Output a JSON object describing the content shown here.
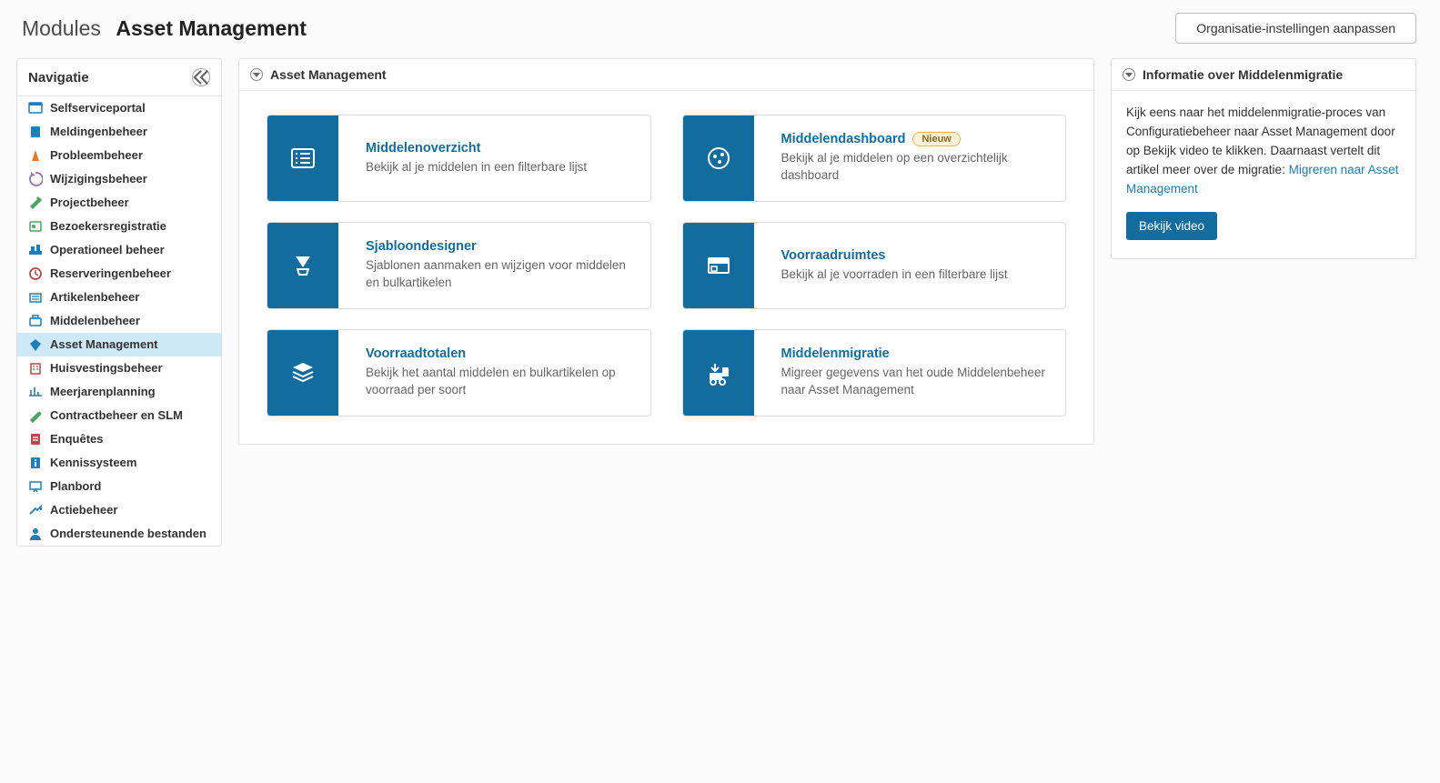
{
  "header": {
    "crumb1": "Modules",
    "crumb2": "Asset Management",
    "org_settings": "Organisatie-instellingen aanpassen"
  },
  "sidebar": {
    "title": "Navigatie",
    "items": [
      {
        "label": "Selfserviceportal",
        "icon": "portal",
        "name": "sidebar-item-selfserviceportal"
      },
      {
        "label": "Meldingenbeheer",
        "icon": "incident",
        "name": "sidebar-item-meldingenbeheer"
      },
      {
        "label": "Probleembeheer",
        "icon": "cone",
        "name": "sidebar-item-probleembeheer"
      },
      {
        "label": "Wijzigingsbeheer",
        "icon": "change",
        "name": "sidebar-item-wijzigingsbeheer"
      },
      {
        "label": "Projectbeheer",
        "icon": "hammer",
        "name": "sidebar-item-projectbeheer"
      },
      {
        "label": "Bezoekersregistratie",
        "icon": "visitor",
        "name": "sidebar-item-bezoekersregistratie"
      },
      {
        "label": "Operationeel beheer",
        "icon": "ops",
        "name": "sidebar-item-operationeel-beheer"
      },
      {
        "label": "Reserveringenbeheer",
        "icon": "clock",
        "name": "sidebar-item-reserveringenbeheer"
      },
      {
        "label": "Artikelenbeheer",
        "icon": "articles",
        "name": "sidebar-item-artikelenbeheer"
      },
      {
        "label": "Middelenbeheer",
        "icon": "assets",
        "name": "sidebar-item-middelenbeheer"
      },
      {
        "label": "Asset Management",
        "icon": "diamond",
        "name": "sidebar-item-asset-management",
        "active": true
      },
      {
        "label": "Huisvestingsbeheer",
        "icon": "building",
        "name": "sidebar-item-huisvestingsbeheer"
      },
      {
        "label": "Meerjarenplanning",
        "icon": "timeline",
        "name": "sidebar-item-meerjarenplanning"
      },
      {
        "label": "Contractbeheer en SLM",
        "icon": "pen",
        "name": "sidebar-item-contractbeheer-en-slm"
      },
      {
        "label": "Enquêtes",
        "icon": "survey",
        "name": "sidebar-item-enquetes"
      },
      {
        "label": "Kennissysteem",
        "icon": "info",
        "name": "sidebar-item-kennissysteem"
      },
      {
        "label": "Planbord",
        "icon": "board",
        "name": "sidebar-item-planbord"
      },
      {
        "label": "Actiebeheer",
        "icon": "action",
        "name": "sidebar-item-actiebeheer"
      },
      {
        "label": "Ondersteunende bestanden",
        "icon": "user",
        "name": "sidebar-item-ondersteunende-bestanden"
      }
    ]
  },
  "main_panel": {
    "title": "Asset Management",
    "cards": [
      {
        "title": "Middelenoverzicht",
        "desc": "Bekijk al je middelen in een filterbare lijst",
        "icon": "list",
        "name": "card-middelenoverzicht"
      },
      {
        "title": "Middelendashboard",
        "desc": "Bekijk al je middelen op een overzichtelijk dashboard",
        "icon": "dashboard",
        "badge": "Nieuw",
        "name": "card-middelendashboard"
      },
      {
        "title": "Sjabloondesigner",
        "desc": "Sjablonen aanmaken en wijzigen voor middelen en bulkartikelen",
        "icon": "design",
        "name": "card-sjabloondesigner"
      },
      {
        "title": "Voorraadruimtes",
        "desc": "Bekijk al je voorraden in een filterbare lijst",
        "icon": "stockroom",
        "name": "card-voorraadruimtes"
      },
      {
        "title": "Voorraadtotalen",
        "desc": "Bekijk het aantal middelen en bulkartikelen op voorraad per soort",
        "icon": "stack",
        "name": "card-voorraadtotalen"
      },
      {
        "title": "Middelenmigratie",
        "desc": "Migreer gegevens van het oude Middelenbeheer naar Asset Management",
        "icon": "migrate",
        "name": "card-middelenmigratie"
      }
    ]
  },
  "info_panel": {
    "title": "Informatie over Middelenmigratie",
    "text_before": "Kijk eens naar het middelenmigratie-proces van Configuratiebeheer naar Asset Management door op Bekijk video te klikken. Daarnaast vertelt dit artikel meer over de migratie: ",
    "link_text": "Migreren naar Asset Management",
    "video_button": "Bekijk video"
  }
}
